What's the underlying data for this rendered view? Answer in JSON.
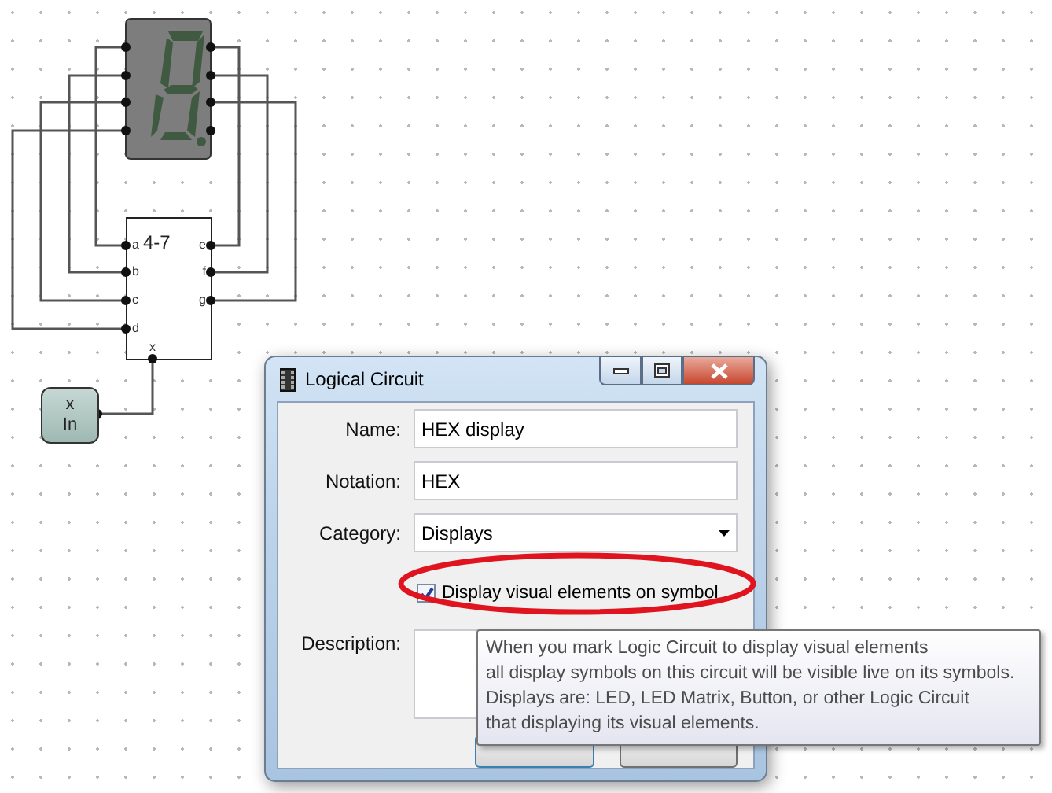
{
  "canvas": {
    "display": {
      "lit": false
    },
    "decoder": {
      "title": "4-7",
      "inputs": [
        "a",
        "b",
        "c",
        "d"
      ],
      "outputs": [
        "e",
        "f",
        "g"
      ],
      "bottom_pin": "x"
    },
    "input_block": {
      "name": "x",
      "label": "In"
    }
  },
  "dialog": {
    "title": "Logical Circuit",
    "fields": [
      {
        "label": "Name:",
        "kind": "text",
        "value": "HEX display"
      },
      {
        "label": "Notation:",
        "kind": "text",
        "value": "HEX"
      },
      {
        "label": "Category:",
        "kind": "dropdown",
        "value": "Displays"
      }
    ],
    "checkbox": {
      "label": "Display visual elements on symbol",
      "checked": true,
      "highlighted": true
    },
    "description": {
      "label": "Description:"
    },
    "tooltip": {
      "lines": [
        "When you mark Logic Circuit to display visual elements",
        "all display symbols on this circuit will be visible live on its symbols.",
        "Displays are: LED, LED Matrix, Button, or other Logic Circuit",
        "that displaying its visual elements."
      ]
    }
  }
}
